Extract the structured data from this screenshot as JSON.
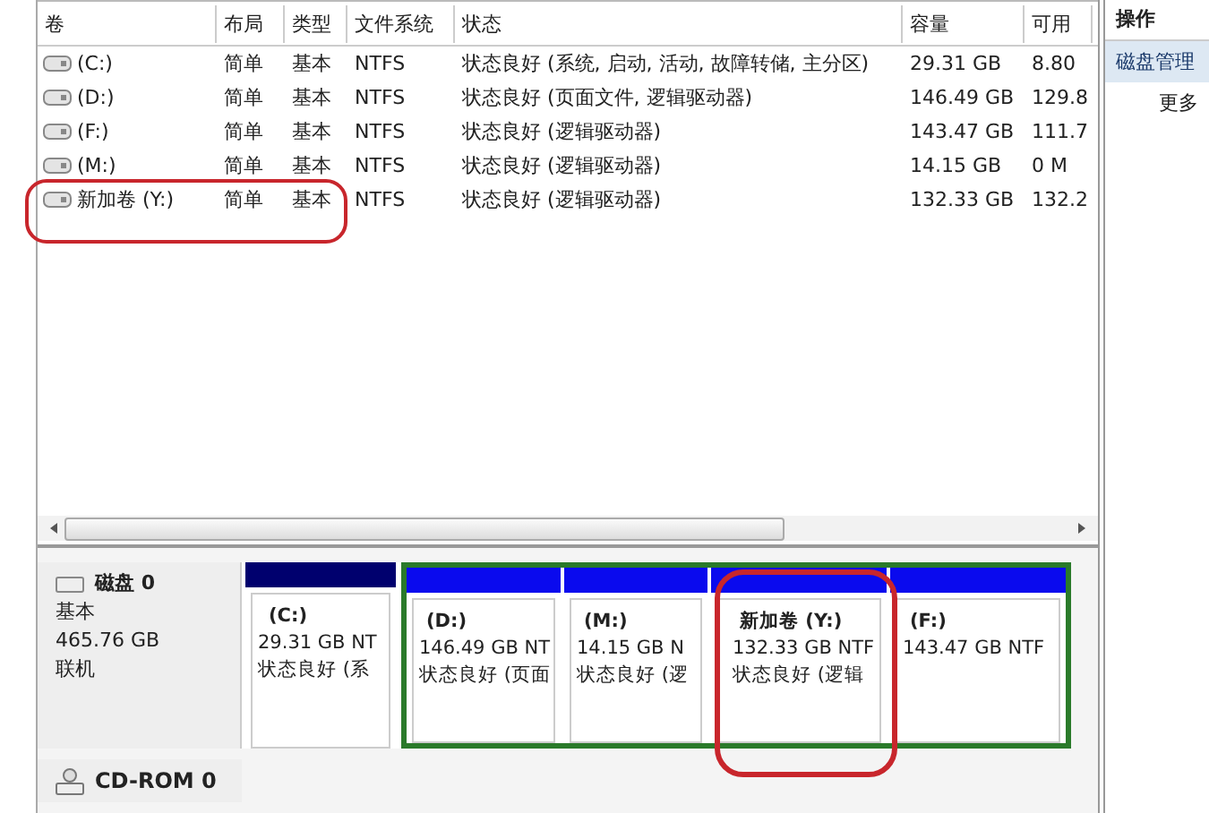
{
  "table": {
    "columns": [
      "卷",
      "布局",
      "类型",
      "文件系统",
      "状态",
      "容量",
      "可用"
    ],
    "rows": [
      {
        "cells": [
          "(C:)",
          "简单",
          "基本",
          "NTFS",
          "状态良好 (系统, 启动, 活动, 故障转储, 主分区)",
          "29.31 GB",
          "8.80"
        ]
      },
      {
        "cells": [
          "(D:)",
          "简单",
          "基本",
          "NTFS",
          "状态良好 (页面文件, 逻辑驱动器)",
          "146.49 GB",
          "129.8"
        ]
      },
      {
        "cells": [
          "(F:)",
          "简单",
          "基本",
          "NTFS",
          "状态良好 (逻辑驱动器)",
          "143.47 GB",
          "111.7"
        ]
      },
      {
        "cells": [
          "(M:)",
          "简单",
          "基本",
          "NTFS",
          "状态良好 (逻辑驱动器)",
          "14.15 GB",
          "0 M"
        ]
      },
      {
        "cells": [
          "新加卷 (Y:)",
          "简单",
          "基本",
          "NTFS",
          "状态良好 (逻辑驱动器)",
          "132.33 GB",
          "132.2"
        ]
      }
    ]
  },
  "actions": {
    "title": "操作",
    "items": [
      {
        "label": "磁盘管理",
        "selected": true
      },
      {
        "label": "更多",
        "selected": false
      }
    ]
  },
  "disks": [
    {
      "kind": "disk",
      "name": "磁盘 0",
      "type": "基本",
      "size": "465.76 GB",
      "status": "联机",
      "partitions": [
        {
          "name": "(C:)",
          "size": "29.31 GB NT",
          "status": "状态良好 (系",
          "kind": "primary"
        },
        {
          "name": "(D:)",
          "size": "146.49 GB NT",
          "status": "状态良好 (页面",
          "kind": "logical"
        },
        {
          "name": "(M:)",
          "size": "14.15 GB N",
          "status": "状态良好 (逻",
          "kind": "logical"
        },
        {
          "name": "新加卷  (Y:)",
          "size": "132.33 GB NTF",
          "status": "状态良好 (逻辑",
          "kind": "logical"
        },
        {
          "name": "(F:)",
          "size": "143.47 GB NTF",
          "kind": "logical"
        }
      ]
    },
    {
      "kind": "cdrom",
      "name": "CD-ROM 0"
    }
  ]
}
